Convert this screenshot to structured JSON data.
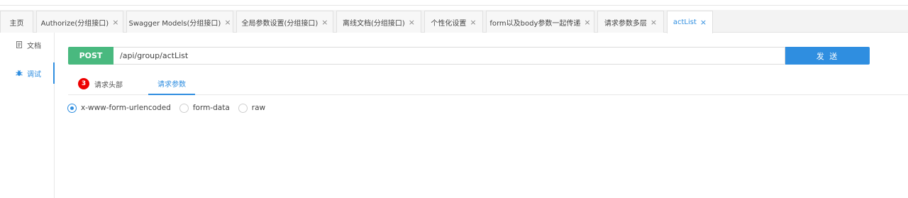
{
  "tabs": [
    {
      "label": "主页",
      "closable": false
    },
    {
      "label": "Authorize(分组接口)",
      "closable": true
    },
    {
      "label": "Swagger Models(分组接口)",
      "closable": true
    },
    {
      "label": "全局参数设置(分组接口)",
      "closable": true
    },
    {
      "label": "离线文档(分组接口)",
      "closable": true
    },
    {
      "label": "个性化设置",
      "closable": true
    },
    {
      "label": "form以及body参数一起传递",
      "closable": true
    },
    {
      "label": "请求参数多层",
      "closable": true
    },
    {
      "label": "actList",
      "closable": true,
      "active": true
    }
  ],
  "tab_close_glyph": "×",
  "sidebar": {
    "items": [
      {
        "label": "文档",
        "icon": "document-icon"
      },
      {
        "label": "调试",
        "icon": "debug-icon",
        "active": true
      }
    ]
  },
  "request": {
    "method": "POST",
    "url": "/api/group/actList",
    "send_label": "发 送"
  },
  "subtabs": {
    "headers_label": "请求头部",
    "headers_count": "3",
    "params_label": "请求参数"
  },
  "body_types": {
    "options": [
      "x-www-form-urlencoded",
      "form-data",
      "raw"
    ],
    "selected": "x-www-form-urlencoded"
  },
  "colors": {
    "accent": "#2f8ee0",
    "method_post": "#49b97f",
    "badge": "#e00000"
  }
}
